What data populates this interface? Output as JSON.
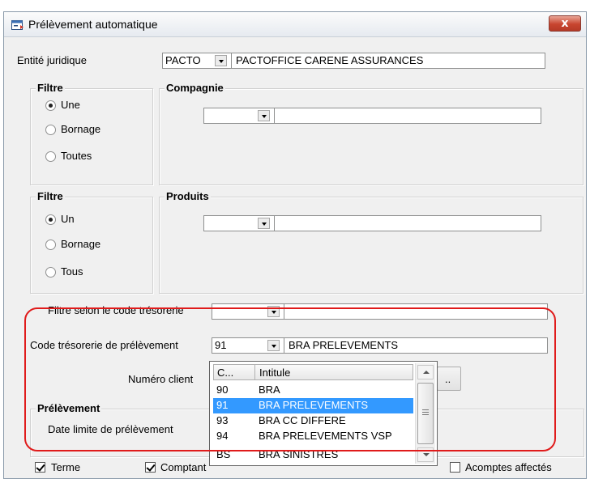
{
  "window": {
    "title": "Prélèvement automatique",
    "close_label": "x"
  },
  "entite": {
    "label": "Entité juridique",
    "code": "PACTO",
    "name": "PACTOFFICE CARENE ASSURANCES"
  },
  "filtre1": {
    "title": "Filtre",
    "options": [
      "Une",
      "Bornage",
      "Toutes"
    ],
    "selected": "Une"
  },
  "compagnie": {
    "title": "Compagnie",
    "code": "",
    "name": ""
  },
  "filtre2": {
    "title": "Filtre",
    "options": [
      "Un",
      "Bornage",
      "Tous"
    ],
    "selected": "Un"
  },
  "produits": {
    "title": "Produits",
    "code": "",
    "name": ""
  },
  "filtre_tresorerie": {
    "label": "Filtre selon le code trésorerie",
    "code": "",
    "name": ""
  },
  "code_tresorerie": {
    "label": "Code trésorerie de prélèvement",
    "code": "91",
    "name": "BRA  PRELEVEMENTS"
  },
  "numero_client": {
    "label": "Numéro client",
    "button_label": ".."
  },
  "dropdown": {
    "columns": [
      "C...",
      "Intitule"
    ],
    "rows": [
      {
        "code": "90",
        "label": "BRA"
      },
      {
        "code": "91",
        "label": "BRA  PRELEVEMENTS"
      },
      {
        "code": "93",
        "label": "BRA CC DIFFERE"
      },
      {
        "code": "94",
        "label": "BRA PRELEVEMENTS VSP"
      },
      {
        "code": "BS",
        "label": "BRA SINISTRES"
      }
    ],
    "selected_code": "91"
  },
  "prelevement": {
    "title": "Prélèvement",
    "date_label": "Date  limite de prélèvement"
  },
  "checkboxes": [
    {
      "label": "Terme",
      "checked": true
    },
    {
      "label": "Comptant",
      "checked": true
    },
    {
      "label": "Acomptes affectés",
      "checked": false
    }
  ],
  "colors": {
    "highlight": "#e01b1b",
    "selection": "#3399ff"
  }
}
